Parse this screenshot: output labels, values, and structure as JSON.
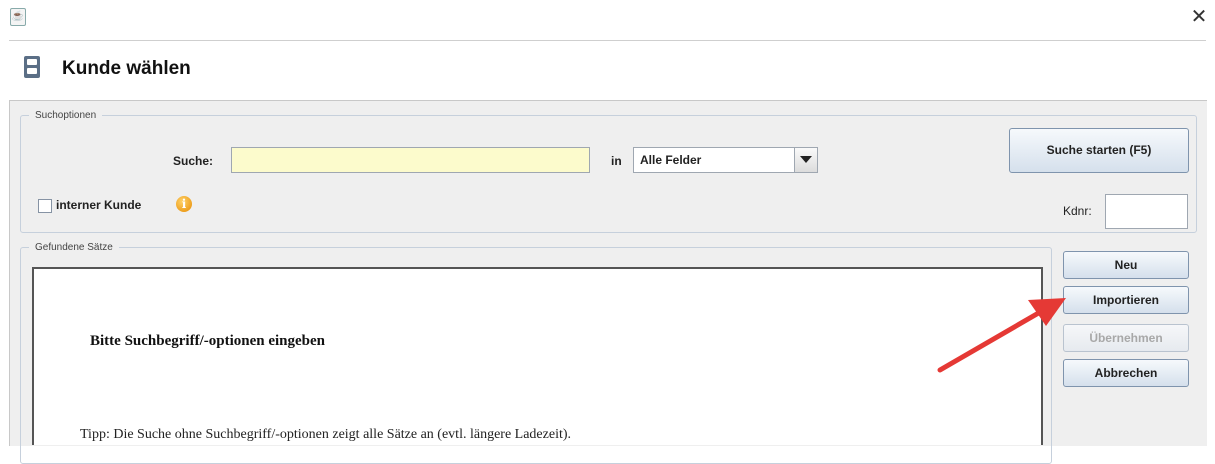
{
  "window": {
    "app_icon": "java-app-icon",
    "close_glyph": "✕"
  },
  "header": {
    "icon": "filing-cabinet-icon",
    "title": "Kunde wählen"
  },
  "search_options": {
    "legend": "Suchoptionen",
    "search_label": "Suche:",
    "search_value": "",
    "in_label": "in",
    "field_select_value": "Alle Felder",
    "search_button": "Suche starten (F5)",
    "internal_customer_label": "interner Kunde",
    "internal_customer_checked": false,
    "info_glyph": "i",
    "kdnr_label": "Kdnr:",
    "kdnr_value": ""
  },
  "results": {
    "legend": "Gefundene Sätze",
    "message": "Bitte Suchbegriff/-optionen eingeben",
    "tip": "Tipp: Die Suche ohne Suchbegriff/-optionen zeigt alle Sätze an (evtl. längere Ladezeit)."
  },
  "actions": [
    {
      "label": "Neu",
      "enabled": true
    },
    {
      "label": "Importieren",
      "enabled": true
    },
    {
      "label": "Übernehmen",
      "enabled": false
    },
    {
      "label": "Abbrechen",
      "enabled": true
    }
  ],
  "colors": {
    "search_field_bg": "#fcfbcc",
    "annotation_arrow": "#e53935",
    "button_gradient_bottom": "#d5e0ec",
    "info_icon": "#f29b05"
  }
}
